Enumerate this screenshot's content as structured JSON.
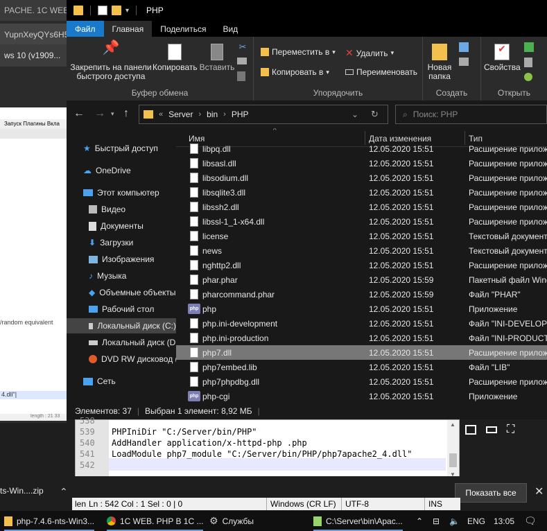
{
  "background_window": {
    "title": "PACHE. 1C WEB |",
    "tab1": "YupnXeyQYs6H5",
    "tab2": "ws 10 (v1909...",
    "menu": "Запуск  Плагины  Вкла",
    "code_line": "/random equivalent",
    "code_line2": "4.dll\"|",
    "status": "length : 21 33"
  },
  "explorer": {
    "title": "PHP",
    "tabs": [
      {
        "label": "Файл"
      },
      {
        "label": "Главная"
      },
      {
        "label": "Поделиться"
      },
      {
        "label": "Вид"
      }
    ],
    "ribbon": {
      "clipboard": {
        "label": "Буфер обмена",
        "pin": "Закрепить на панели быстрого доступа",
        "copy": "Копировать",
        "paste": "Вставить"
      },
      "organize": {
        "label": "Упорядочить",
        "move": "Переместить в",
        "copy_to": "Копировать в",
        "delete": "Удалить",
        "rename": "Переименовать"
      },
      "create": {
        "label": "Создать",
        "new_folder": "Новая папка"
      },
      "open": {
        "label": "Открыть",
        "properties": "Свойства"
      }
    },
    "address": {
      "prefix": "«",
      "crumbs": [
        "Server",
        "bin",
        "PHP"
      ]
    },
    "search_placeholder": "Поиск: PHP",
    "nav": [
      {
        "label": "Быстрый доступ",
        "icon": "star-icon"
      },
      {
        "label": "OneDrive",
        "icon": "cloud-icon"
      },
      {
        "label": "Этот компьютер",
        "icon": "computer-icon"
      },
      {
        "label": "Видео",
        "icon": "video-icon"
      },
      {
        "label": "Документы",
        "icon": "documents-icon"
      },
      {
        "label": "Загрузки",
        "icon": "downloads-icon"
      },
      {
        "label": "Изображения",
        "icon": "pictures-icon"
      },
      {
        "label": "Музыка",
        "icon": "music-icon"
      },
      {
        "label": "Объемные объекты",
        "icon": "3d-objects-icon"
      },
      {
        "label": "Рабочий стол",
        "icon": "desktop-icon"
      },
      {
        "label": "Локальный диск (C:)",
        "icon": "drive-c-icon"
      },
      {
        "label": "Локальный диск (D:)",
        "icon": "drive-d-icon"
      },
      {
        "label": "DVD RW дисковод (E:)",
        "icon": "dvd-icon"
      },
      {
        "label": "Сеть",
        "icon": "network-icon"
      }
    ],
    "columns": {
      "name": "Имя",
      "date": "Дата изменения",
      "type": "Тип"
    },
    "files": [
      {
        "name": "libpq.dll",
        "date": "12.05.2020 15:51",
        "type": "Расширение приложения",
        "icon": "dll"
      },
      {
        "name": "libsasl.dll",
        "date": "12.05.2020 15:51",
        "type": "Расширение приложения",
        "icon": "dll"
      },
      {
        "name": "libsodium.dll",
        "date": "12.05.2020 15:51",
        "type": "Расширение приложения",
        "icon": "dll"
      },
      {
        "name": "libsqlite3.dll",
        "date": "12.05.2020 15:51",
        "type": "Расширение приложения",
        "icon": "dll"
      },
      {
        "name": "libssh2.dll",
        "date": "12.05.2020 15:51",
        "type": "Расширение приложения",
        "icon": "dll"
      },
      {
        "name": "libssl-1_1-x64.dll",
        "date": "12.05.2020 15:51",
        "type": "Расширение приложения",
        "icon": "dll"
      },
      {
        "name": "license",
        "date": "12.05.2020 15:51",
        "type": "Текстовый документ",
        "icon": "doc"
      },
      {
        "name": "news",
        "date": "12.05.2020 15:51",
        "type": "Текстовый документ",
        "icon": "doc"
      },
      {
        "name": "nghttp2.dll",
        "date": "12.05.2020 15:51",
        "type": "Расширение приложения",
        "icon": "dll"
      },
      {
        "name": "phar.phar",
        "date": "12.05.2020 15:59",
        "type": "Пакетный файл Windows",
        "icon": "dll"
      },
      {
        "name": "pharcommand.phar",
        "date": "12.05.2020 15:59",
        "type": "Файл \"PHAR\"",
        "icon": "doc"
      },
      {
        "name": "php",
        "date": "12.05.2020 15:51",
        "type": "Приложение",
        "icon": "php"
      },
      {
        "name": "php.ini-development",
        "date": "12.05.2020 15:51",
        "type": "Файл \"INI-DEVELOPMENT\"",
        "icon": "doc"
      },
      {
        "name": "php.ini-production",
        "date": "12.05.2020 15:51",
        "type": "Файл \"INI-PRODUCTION\"",
        "icon": "doc"
      },
      {
        "name": "php7.dll",
        "date": "12.05.2020 15:51",
        "type": "Расширение приложения",
        "icon": "dll",
        "selected": true
      },
      {
        "name": "php7embed.lib",
        "date": "12.05.2020 15:51",
        "type": "Файл \"LIB\"",
        "icon": "doc"
      },
      {
        "name": "php7phpdbg.dll",
        "date": "12.05.2020 15:51",
        "type": "Расширение приложения",
        "icon": "dll"
      },
      {
        "name": "php-cgi",
        "date": "12.05.2020 15:51",
        "type": "Приложение",
        "icon": "php"
      }
    ],
    "status": {
      "items": "Элементов: 37",
      "selected": "Выбран 1 элемент: 8,92 МБ"
    }
  },
  "editor": {
    "lines": [
      {
        "n": "538",
        "text": ""
      },
      {
        "n": "539",
        "text": "PHPIniDir \"C:/Server/bin/PHP\""
      },
      {
        "n": "540",
        "text": "AddHandler application/x-httpd-php .php"
      },
      {
        "n": "541",
        "text": "LoadModule php7_module \"C:/Server/bin/PHP/php7apache2_4.dll\""
      },
      {
        "n": "542",
        "text": ""
      }
    ],
    "status": {
      "len": "len",
      "pos": "Ln : 542   Col : 1    Sel : 0 | 0",
      "eol": "Windows (CR LF)",
      "enc": "UTF-8",
      "ins": "INS"
    }
  },
  "downloads": {
    "item": "ts-Win....zip",
    "show_all": "Показать все"
  },
  "taskbar": {
    "items": [
      {
        "label": "php-7.4.6-nts-Win3...",
        "icon": "zip-icon"
      },
      {
        "label": "1C WEB. PHP В 1С ...",
        "icon": "chrome-icon"
      },
      {
        "label": "Службы",
        "icon": "services-gear-icon"
      },
      {
        "label": "C:\\Server\\bin\\Apac...",
        "icon": "notepadpp-icon"
      }
    ],
    "lang": "ENG",
    "time": "13:05"
  }
}
